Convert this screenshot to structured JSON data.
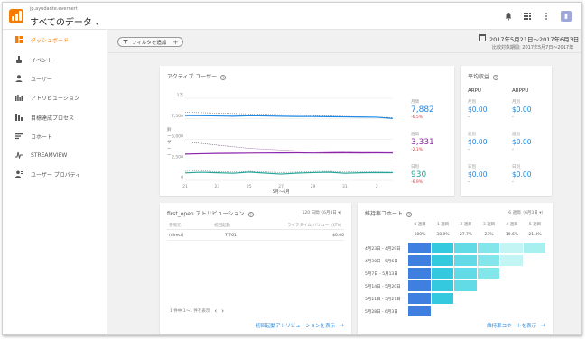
{
  "header": {
    "account": "jp.ayudante.evernert",
    "property": "すべてのデータ",
    "caret": "▾",
    "icons": [
      "bell-icon",
      "apps-icon",
      "more-vert-icon"
    ],
    "avatar_initial": "▮"
  },
  "sidebar": {
    "items": [
      {
        "label": "ダッシュボード",
        "icon": "dashboard-icon",
        "active": true
      },
      {
        "label": "イベント",
        "icon": "touch-icon"
      },
      {
        "label": "ユーザー",
        "icon": "person-icon"
      },
      {
        "label": "アトリビューション",
        "icon": "attribution-icon"
      },
      {
        "label": "目標達成プロセス",
        "icon": "funnel-icon"
      },
      {
        "label": "コホート",
        "icon": "cohort-icon"
      },
      {
        "label": "STREAMVIEW",
        "icon": "streamview-icon"
      },
      {
        "label": "ユーザー プロパティ",
        "icon": "user-properties-icon"
      }
    ]
  },
  "filterbar": {
    "filter_label": "フィルタを追加",
    "date_range": "2017年5月21日～2017年6月3日",
    "compare": "比較対象期間: 2017年5月7日～2017年"
  },
  "active_users": {
    "title": "アクティブ ユーザー",
    "y_ticks": [
      "1万",
      "7,500",
      "5,000",
      "2,500",
      "0"
    ],
    "y_axis_title": [
      "鈴",
      "ー",
      "ザ",
      "ー",
      "ー"
    ],
    "x_ticks": [
      "21",
      "23",
      "25",
      "27",
      "29",
      "31",
      "2"
    ],
    "x_month": "5月～6月",
    "metrics": [
      {
        "label": "月間",
        "value": "7,882",
        "delta": "-6.5%",
        "color": "#1e88e5"
      },
      {
        "label": "週間",
        "value": "3,331",
        "delta": "-2.1%",
        "color": "#8e24aa"
      },
      {
        "label": "日別",
        "value": "930",
        "delta": "-6.9%",
        "color": "#26a69a"
      }
    ]
  },
  "chart_data": {
    "type": "line",
    "x": [
      "21",
      "22",
      "23",
      "24",
      "25",
      "26",
      "27",
      "28",
      "29",
      "30",
      "31",
      "1",
      "2",
      "3"
    ],
    "ylim": [
      0,
      10000
    ],
    "series": [
      {
        "values": [
          7900,
          7880,
          7850,
          7820,
          7880,
          7850,
          7820,
          7790,
          7780,
          7760,
          7740,
          7720,
          7700,
          7550
        ],
        "color": "#1e88e5"
      },
      {
        "values": [
          8300,
          8250,
          8200,
          8150,
          8100,
          8050,
          8000,
          7950,
          7900,
          7850,
          7800,
          7750,
          7700,
          7650
        ],
        "color": "#1e88e5",
        "dashed": true
      },
      {
        "values": [
          3200,
          3250,
          3280,
          3300,
          3320,
          3330,
          3340,
          3350,
          3330,
          3340,
          3350,
          3340,
          3350,
          3331
        ],
        "color": "#8e24aa"
      },
      {
        "values": [
          4700,
          4500,
          4300,
          4100,
          3900,
          3800,
          3700,
          3600,
          3550,
          3500,
          3450,
          3420,
          3400,
          3400
        ],
        "color": "#8e24aa",
        "dashed": true
      },
      {
        "values": [
          900,
          980,
          920,
          860,
          1000,
          880,
          760,
          880,
          940,
          990,
          860,
          920,
          950,
          930
        ],
        "color": "#26a69a"
      },
      {
        "values": [
          1100,
          1150,
          1050,
          1000,
          1100,
          1020,
          950,
          1000,
          1080,
          1100,
          1000,
          1050,
          1020,
          980
        ],
        "color": "#26a69a",
        "dashed": true
      }
    ]
  },
  "avg_revenue": {
    "title": "平均収益",
    "cols": [
      {
        "head": "ARPU",
        "rows": [
          {
            "label": "月別",
            "value": "$0.00",
            "delta": "-"
          },
          {
            "label": "週別",
            "value": "$0.00",
            "delta": "-"
          },
          {
            "label": "日別",
            "value": "$0.00",
            "delta": "-"
          }
        ]
      },
      {
        "head": "ARPPU",
        "rows": [
          {
            "label": "月別",
            "value": "$0.00",
            "delta": "-"
          },
          {
            "label": "週別",
            "value": "$0.00",
            "delta": "-"
          },
          {
            "label": "日別",
            "value": "$0.00",
            "delta": "-"
          }
        ]
      }
    ]
  },
  "attribution": {
    "title": "first_open アトリビューション",
    "range": "120 日間（6月3日 ▾）",
    "headers": [
      "参照元",
      "初回起動",
      "ライフタイム バリュー（LTV）"
    ],
    "row": [
      "(direct)",
      "7,761",
      "$0.00"
    ],
    "pager": "1 件中 1～1 件を表示",
    "prev": "‹",
    "next": "›",
    "link": "初回起動アトリビューションを表示",
    "arrow": "→"
  },
  "cohort": {
    "title": "維持率コホート",
    "range": "6 週間（6月3日 ▾）",
    "headers": [
      "0 週目",
      "1 週目",
      "2 週目",
      "3 週目",
      "4 週目",
      "5 週目"
    ],
    "pcts": [
      "100%",
      "38.9%",
      "27.7%",
      "23%",
      "19.6%",
      "21.3%"
    ],
    "rows": [
      {
        "label": "4月23日 - 4月29日",
        "cells": [
          1.0,
          0.389,
          0.277,
          0.23,
          0.196,
          0.213
        ]
      },
      {
        "label": "4月30日 - 5月6日",
        "cells": [
          1.0,
          0.389,
          0.277,
          0.23,
          0.196
        ]
      },
      {
        "label": "5月7日 - 5月13日",
        "cells": [
          1.0,
          0.389,
          0.277,
          0.23
        ]
      },
      {
        "label": "5月14日 - 5月20日",
        "cells": [
          1.0,
          0.389,
          0.277
        ]
      },
      {
        "label": "5月21日 - 5月27日",
        "cells": [
          1.0,
          0.389
        ]
      },
      {
        "label": "5月28日 - 6月3日",
        "cells": [
          1.0
        ]
      }
    ],
    "link": "維持率コホートを表示",
    "arrow": "→"
  }
}
